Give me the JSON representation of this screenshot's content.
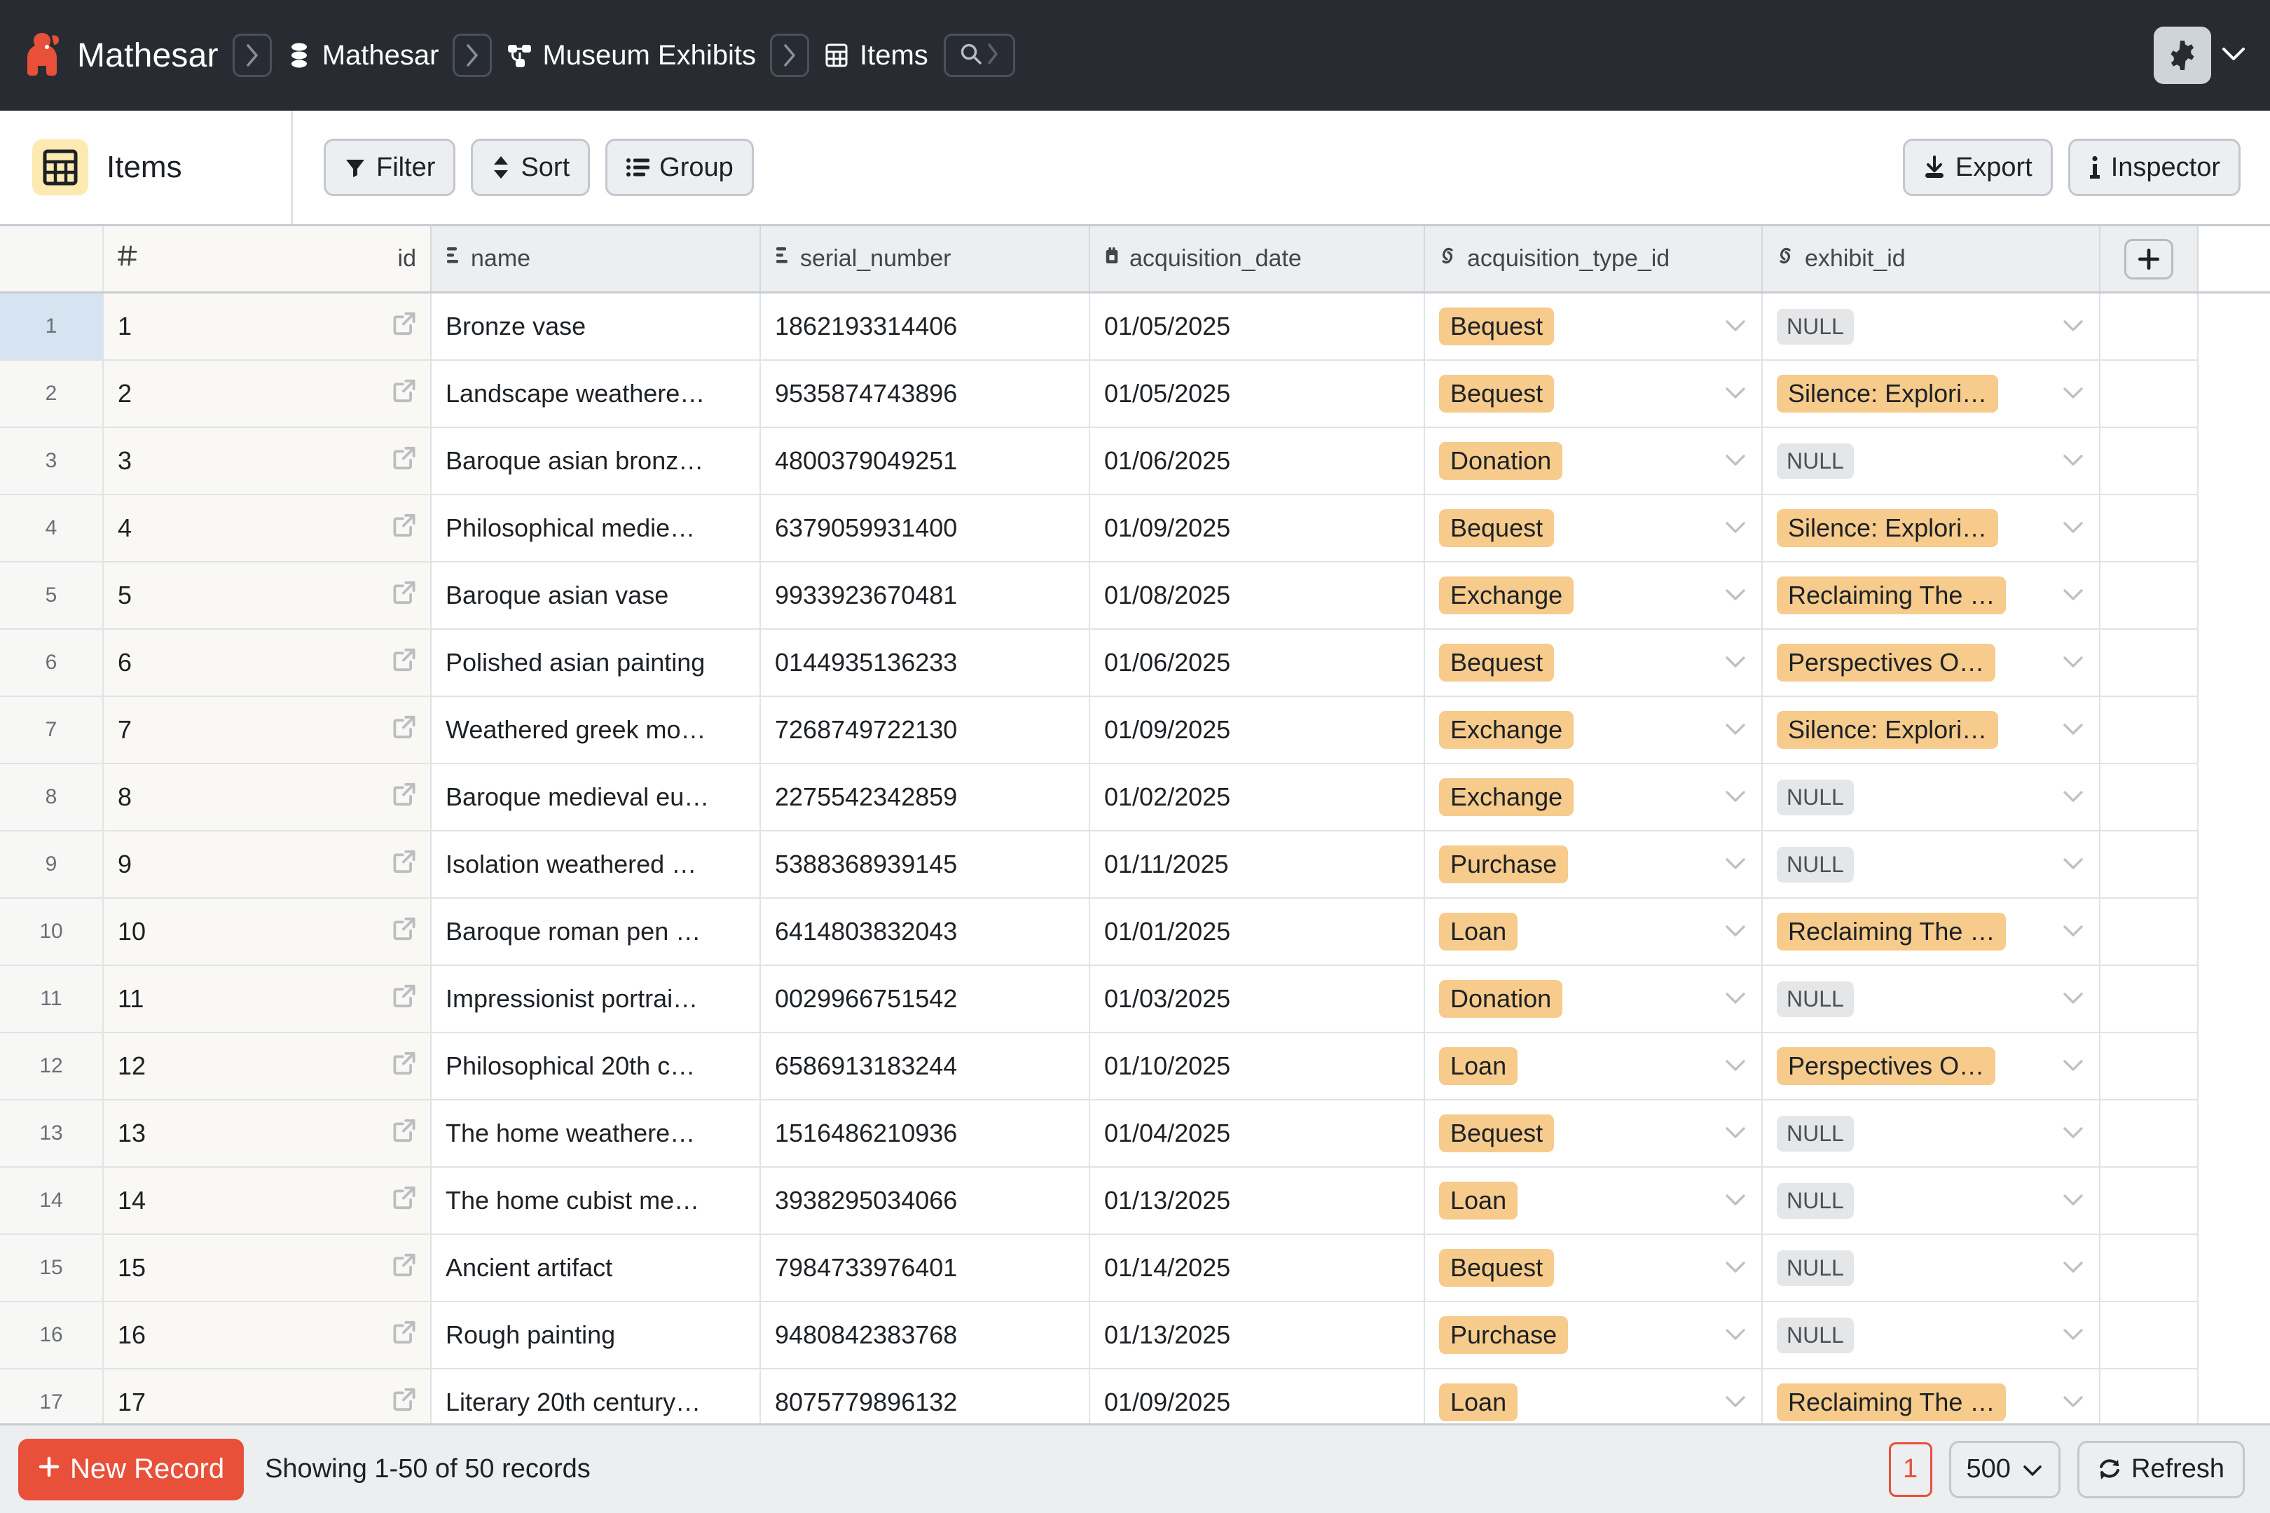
{
  "topbar": {
    "brand": "Mathesar",
    "logo_icon": "mathesar-elephant-logo",
    "breadcrumbs": [
      {
        "label": "Mathesar",
        "icon": "database-icon"
      },
      {
        "label": "Museum Exhibits",
        "icon": "schema-network-icon"
      },
      {
        "label": "Items",
        "icon": "table-grid-icon"
      }
    ],
    "separator_icon": "chevron-right-icon",
    "search_icon": "search-icon",
    "search_chevron_icon": "chevron-right-icon",
    "settings_icon": "gear-icon",
    "settings_chevron_icon": "chevron-down-icon"
  },
  "toolbar": {
    "table_icon": "table-grid-icon",
    "table_name": "Items",
    "filter_label": "Filter",
    "filter_icon": "funnel-icon",
    "sort_label": "Sort",
    "sort_icon": "sort-updown-icon",
    "group_label": "Group",
    "group_icon": "list-group-icon",
    "export_label": "Export",
    "export_icon": "download-icon",
    "inspector_label": "Inspector",
    "inspector_icon": "info-icon"
  },
  "table": {
    "add_column_icon": "plus-icon",
    "row_open_icon": "external-link-icon",
    "cell_chevron_icon": "chevron-down-icon",
    "null_label": "NULL",
    "columns": [
      {
        "key": "id",
        "label": "id",
        "icon": "hash-icon",
        "selected": true
      },
      {
        "key": "name",
        "label": "name",
        "icon": "text-lines-icon",
        "selected": false
      },
      {
        "key": "serial_number",
        "label": "serial_number",
        "icon": "text-lines-icon",
        "selected": false
      },
      {
        "key": "acquisition_date",
        "label": "acquisition_date",
        "icon": "calendar-icon",
        "selected": false
      },
      {
        "key": "acquisition_type_id",
        "label": "acquisition_type_id",
        "icon": "link-icon",
        "selected": false
      },
      {
        "key": "exhibit_id",
        "label": "exhibit_id",
        "icon": "link-icon",
        "selected": false
      }
    ],
    "rows": [
      {
        "n": "1",
        "id": "1",
        "name": "Bronze vase",
        "serial_number": "1862193314406",
        "acquisition_date": "01/05/2025",
        "acquisition_type_id": "Bequest",
        "exhibit_id": "NULL"
      },
      {
        "n": "2",
        "id": "2",
        "name": "Landscape weathere…",
        "serial_number": "9535874743896",
        "acquisition_date": "01/05/2025",
        "acquisition_type_id": "Bequest",
        "exhibit_id": "Silence: Explori…"
      },
      {
        "n": "3",
        "id": "3",
        "name": "Baroque asian bronz…",
        "serial_number": "4800379049251",
        "acquisition_date": "01/06/2025",
        "acquisition_type_id": "Donation",
        "exhibit_id": "NULL"
      },
      {
        "n": "4",
        "id": "4",
        "name": "Philosophical medie…",
        "serial_number": "6379059931400",
        "acquisition_date": "01/09/2025",
        "acquisition_type_id": "Bequest",
        "exhibit_id": "Silence: Explori…"
      },
      {
        "n": "5",
        "id": "5",
        "name": "Baroque asian vase",
        "serial_number": "9933923670481",
        "acquisition_date": "01/08/2025",
        "acquisition_type_id": "Exchange",
        "exhibit_id": "Reclaiming The …"
      },
      {
        "n": "6",
        "id": "6",
        "name": "Polished asian painting",
        "serial_number": "0144935136233",
        "acquisition_date": "01/06/2025",
        "acquisition_type_id": "Bequest",
        "exhibit_id": "Perspectives O…"
      },
      {
        "n": "7",
        "id": "7",
        "name": "Weathered greek mo…",
        "serial_number": "7268749722130",
        "acquisition_date": "01/09/2025",
        "acquisition_type_id": "Exchange",
        "exhibit_id": "Silence: Explori…"
      },
      {
        "n": "8",
        "id": "8",
        "name": "Baroque medieval eu…",
        "serial_number": "2275542342859",
        "acquisition_date": "01/02/2025",
        "acquisition_type_id": "Exchange",
        "exhibit_id": "NULL"
      },
      {
        "n": "9",
        "id": "9",
        "name": "Isolation weathered …",
        "serial_number": "5388368939145",
        "acquisition_date": "01/11/2025",
        "acquisition_type_id": "Purchase",
        "exhibit_id": "NULL"
      },
      {
        "n": "10",
        "id": "10",
        "name": "Baroque roman pen …",
        "serial_number": "6414803832043",
        "acquisition_date": "01/01/2025",
        "acquisition_type_id": "Loan",
        "exhibit_id": "Reclaiming The …"
      },
      {
        "n": "11",
        "id": "11",
        "name": "Impressionist portrai…",
        "serial_number": "0029966751542",
        "acquisition_date": "01/03/2025",
        "acquisition_type_id": "Donation",
        "exhibit_id": "NULL"
      },
      {
        "n": "12",
        "id": "12",
        "name": "Philosophical 20th c…",
        "serial_number": "6586913183244",
        "acquisition_date": "01/10/2025",
        "acquisition_type_id": "Loan",
        "exhibit_id": "Perspectives O…"
      },
      {
        "n": "13",
        "id": "13",
        "name": "The home weathere…",
        "serial_number": "1516486210936",
        "acquisition_date": "01/04/2025",
        "acquisition_type_id": "Bequest",
        "exhibit_id": "NULL"
      },
      {
        "n": "14",
        "id": "14",
        "name": "The home cubist me…",
        "serial_number": "3938295034066",
        "acquisition_date": "01/13/2025",
        "acquisition_type_id": "Loan",
        "exhibit_id": "NULL"
      },
      {
        "n": "15",
        "id": "15",
        "name": "Ancient artifact",
        "serial_number": "7984733976401",
        "acquisition_date": "01/14/2025",
        "acquisition_type_id": "Bequest",
        "exhibit_id": "NULL"
      },
      {
        "n": "16",
        "id": "16",
        "name": "Rough painting",
        "serial_number": "9480842383768",
        "acquisition_date": "01/13/2025",
        "acquisition_type_id": "Purchase",
        "exhibit_id": "NULL"
      },
      {
        "n": "17",
        "id": "17",
        "name": "Literary 20th century…",
        "serial_number": "8075779896132",
        "acquisition_date": "01/09/2025",
        "acquisition_type_id": "Loan",
        "exhibit_id": "Reclaiming The …"
      }
    ]
  },
  "footer": {
    "new_record_label": "New Record",
    "new_record_icon": "plus-icon",
    "showing_text": "Showing 1-50 of 50 records",
    "page_number": "1",
    "page_size": "500",
    "page_size_chevron_icon": "chevron-down-icon",
    "refresh_label": "Refresh",
    "refresh_icon": "refresh-icon"
  },
  "colors": {
    "brand_red": "#e8503a",
    "topbar_bg": "#282c32",
    "pill_amber": "#f6cb8b",
    "selected_col": "#d6e4f2",
    "table_icon_bg": "#fdeab0"
  }
}
